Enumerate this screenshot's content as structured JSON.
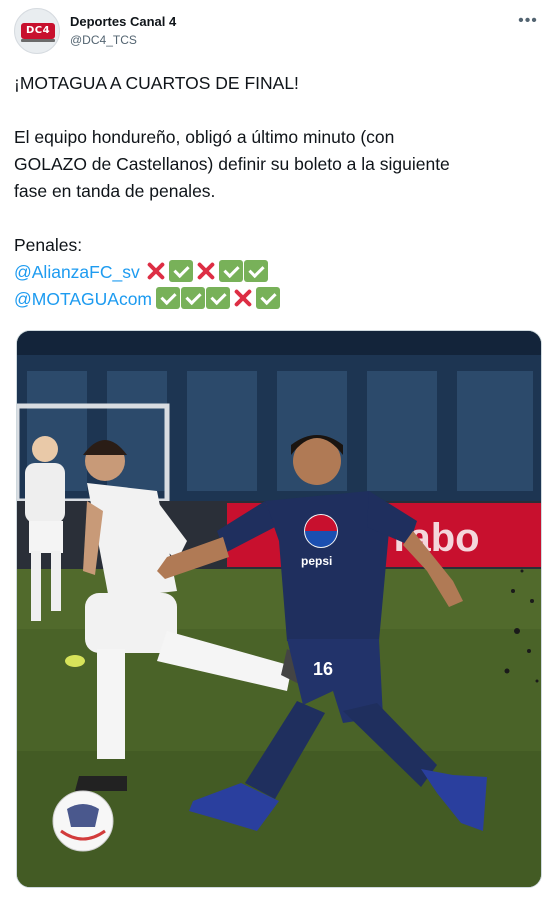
{
  "author": {
    "display_name": "Deportes Canal 4",
    "handle": "@DC4_TCS",
    "avatar_logo_text": "DC4"
  },
  "more_icon": "more-horizontal-icon",
  "tweet": {
    "headline": "¡MOTAGUA A CUARTOS DE FINAL!",
    "paragraph_lines": [
      "El equipo hondureño, obligó a último minuto (con",
      "GOLAZO de Castellanos) definir su boleto a la siguiente",
      "fase en tanda de penales."
    ],
    "penalties_label": "Penales:",
    "penalties": [
      {
        "team": "@AlianzaFC_sv",
        "results": [
          "miss",
          "goal",
          "miss",
          "goal",
          "goal"
        ]
      },
      {
        "team": "@MOTAGUAcom",
        "results": [
          "goal",
          "goal",
          "goal",
          "miss",
          "goal"
        ]
      }
    ]
  },
  "media": {
    "kind": "photo",
    "banner_text": "Tabo",
    "sponsor_text": "pepsi",
    "jersey_number": "16",
    "colors": {
      "pitch": "#4a6328",
      "stands": "#1d3552",
      "home_kit": "#1f2f5e",
      "away_kit": "#f2f2f2",
      "accent_red": "#c8102e"
    }
  },
  "colors": {
    "link": "#1d9bf0",
    "check": "#78b159",
    "cross": "#dd2e44",
    "text": "#0f1419",
    "muted": "#536471"
  }
}
